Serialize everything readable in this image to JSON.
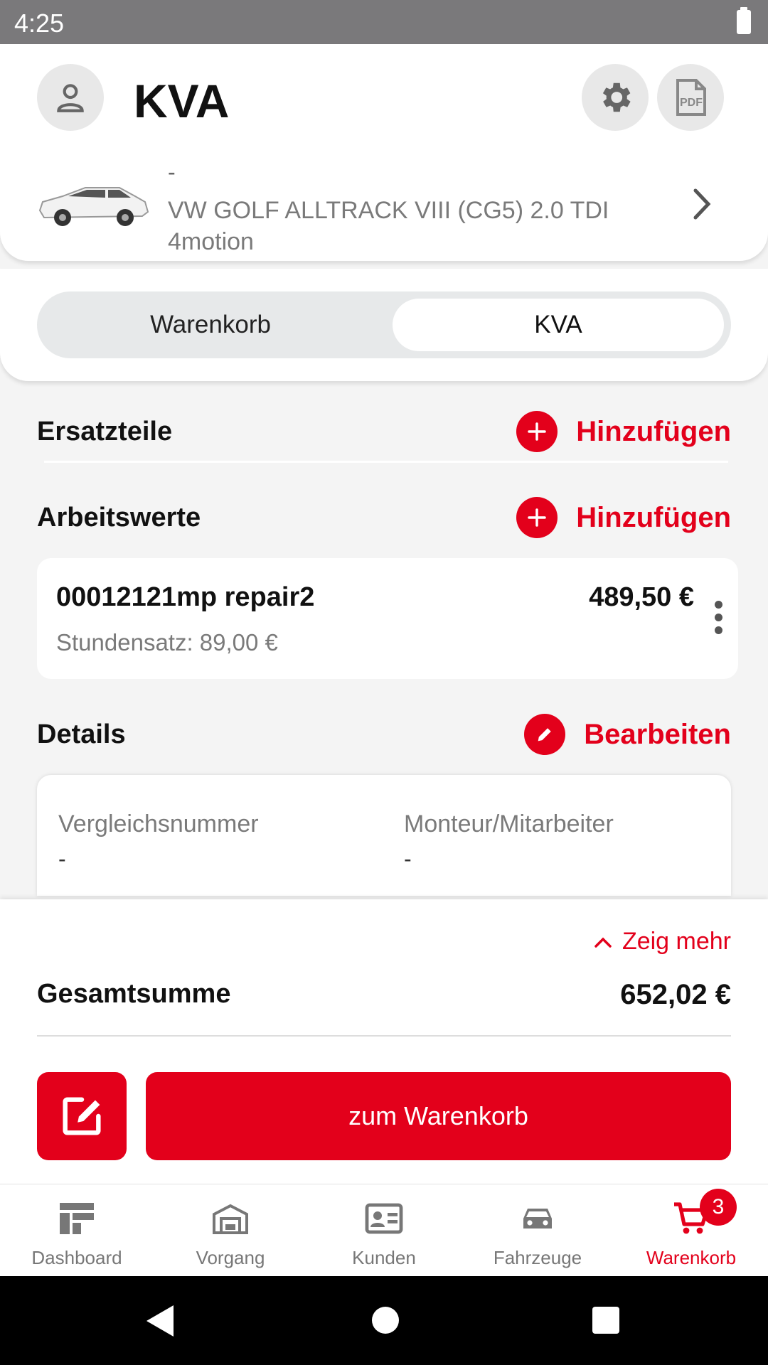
{
  "status_bar": {
    "time": "4:25"
  },
  "header": {
    "title": "KVA",
    "vehicle_dash": "-",
    "vehicle_name": "VW GOLF ALLTRACK VIII (CG5) 2.0 TDI 4motion"
  },
  "segment": {
    "left": "Warenkorb",
    "right": "KVA",
    "selected": "KVA"
  },
  "sections": {
    "parts_title": "Ersatzteile",
    "parts_add": "Hinzufügen",
    "labour_title": "Arbeitswerte",
    "labour_add": "Hinzufügen",
    "details_title": "Details",
    "details_edit": "Bearbeiten"
  },
  "labour_item": {
    "name": "00012121mp repair2",
    "rate": "Stundensatz: 89,00 €",
    "price": "489,50 €"
  },
  "details": {
    "col1_label": "Vergleichsnummer",
    "col1_value": "-",
    "col2_label": "Monteur/Mitarbeiter",
    "col2_value": "-"
  },
  "summary": {
    "show_more": "Zeig mehr",
    "total_label": "Gesamtsumme",
    "total_value": "652,02 €",
    "cart_button": "zum Warenkorb"
  },
  "bottom_nav": {
    "items": [
      {
        "label": "Dashboard",
        "icon": "dashboard-icon"
      },
      {
        "label": "Vorgang",
        "icon": "garage-icon"
      },
      {
        "label": "Kunden",
        "icon": "id-card-icon"
      },
      {
        "label": "Fahrzeuge",
        "icon": "car-icon"
      },
      {
        "label": "Warenkorb",
        "icon": "cart-icon"
      }
    ],
    "active": "Warenkorb",
    "cart_badge": "3"
  },
  "colors": {
    "accent": "#e3001b",
    "status_bar": "#7a797b"
  }
}
